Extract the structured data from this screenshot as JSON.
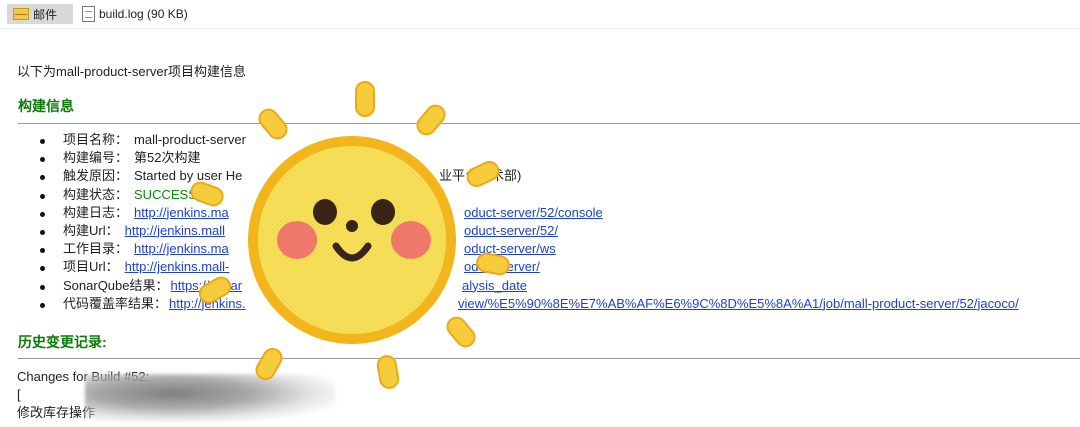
{
  "topbar": {
    "mail_tab_label": "邮件",
    "attachment": "build.log (90 KB)"
  },
  "intro": "以下为mall-product-server项目构建信息",
  "section_build": "构建信息",
  "section_history": "历史变更记录:",
  "build_info": {
    "items": [
      {
        "label": "项目名称：",
        "value": "mall-product-server"
      },
      {
        "label": "构建编号：",
        "value": "第52次构建"
      },
      {
        "label": "触发原因：",
        "value": "Started by user He"
      },
      {
        "label": "构建状态：",
        "value": "SUCCESS"
      },
      {
        "label": "构建日志：",
        "value": "http://jenkins.ma"
      },
      {
        "label": "构建Url：",
        "value": "http://jenkins.mall"
      },
      {
        "label": "工作目录：",
        "value": "http://jenkins.ma"
      },
      {
        "label": "项目Url：",
        "value": "http://jenkins.mall-"
      },
      {
        "label": "SonarQube结果：",
        "value": "https://sonar"
      },
      {
        "label": "代码覆盖率结果：",
        "value": "http://jenkins."
      }
    ],
    "right_fragments": {
      "trigger": "业平台技术部)",
      "log": "oduct-server/52/console",
      "url": "oduct-server/52/",
      "workspace": "oduct-server/ws",
      "project": "oduct-server/",
      "sonar": "alysis_date",
      "coverage": "view/%E5%90%8E%E7%AB%AF%E6%9C%8D%E5%8A%A1/job/mall-product-server/52/jacoco/"
    }
  },
  "changes": {
    "line1": "Changes for Build #52:",
    "line2": "[",
    "line3": "修改库存操作"
  },
  "colors": {
    "section_green": "#0b7a0b",
    "link_blue": "#1b3fd8",
    "sun_yellow": "#f8e15a",
    "sun_outline": "#f2b61c",
    "cheek_pink": "#f0786a"
  },
  "sticker": {
    "icon": "sun-face-sticker-icon"
  }
}
